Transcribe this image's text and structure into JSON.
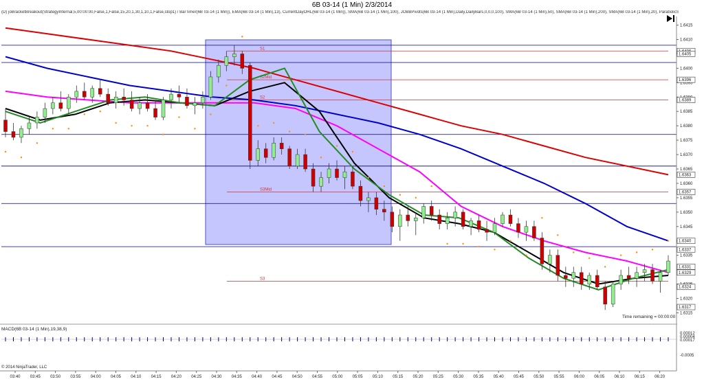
{
  "header": {
    "title": "6B 03-14 (1 Min)  2/3/2014",
    "indicators": "(D) joBracketBreakout(StrategyInternal,5,00:00:00,False,1,False,15,20,1,30,1,10,1,False,stop1) / BarTimer(6B 03-14 (1 Min)), EMA(6B 03-14 (1 Min),13), CurrentDayOHL(6B 03-14 (1 Min)), SMA(6B 03-14 (1 Min),100), JOBBPivots(6B 03-14 (1 Min),Daily,DailyBars,0,0,0,100), SMA(6B 03-14 (1 Min),50), SMA(6B 03-14 (1 Min),200), SMA(6B 03-14 (1 Min),20), ParabolicSAR(6B"
  },
  "footer": {
    "copyright": "© 2014 NinjaTrader, LLC",
    "time_remaining": "Time remaining = 00:00:00",
    "macd_label": "MACD(6B 03-14 (1 Min),19,38,9)"
  },
  "colors": {
    "up": "#90ee90",
    "down": "#cc0000",
    "ema13": "#228b22",
    "sma20": "#000000",
    "sma50": "#ff00ff",
    "sma100": "#0000cd",
    "sma200": "#dd0000",
    "psar": "#ff8c00",
    "pivot_line": "#cc3333",
    "day_line": "#000080",
    "box": "#8080ff"
  },
  "chart_data": {
    "type": "candlestick",
    "x_ticks": [
      "03:40",
      "03:45",
      "03:50",
      "03:55",
      "04:00",
      "04:05",
      "04:10",
      "04:15",
      "04:20",
      "04:25",
      "04:30",
      "04:35",
      "04:40",
      "04:45",
      "04:50",
      "04:55",
      "05:00",
      "05:05",
      "05:10",
      "05:15",
      "05:20",
      "05:25",
      "05:30",
      "05:35",
      "05:40",
      "05:45",
      "05:50",
      "05:55",
      "06:00",
      "06:05",
      "06:10",
      "06:15",
      "06:20"
    ],
    "y_ticks": [
      "1.6415",
      "1.6410",
      "1.6405",
      "1.6400",
      "1.6395",
      "1.6390",
      "1.6385",
      "1.6380",
      "1.6375",
      "1.6370",
      "1.6365",
      "1.6360",
      "1.6355",
      "1.6350",
      "1.6345",
      "1.6340",
      "1.6335",
      "1.6330",
      "1.6325",
      "1.6320",
      "1.6315"
    ],
    "ylim": [
      1.6312,
      1.6418
    ],
    "pivots": [
      {
        "name": "S1",
        "value": 1.6406
      },
      {
        "name": "S2Mid",
        "value": 1.6396
      },
      {
        "name": "S2",
        "value": 1.6389
      },
      {
        "name": "S3Mid",
        "value": 1.6357
      },
      {
        "name": "S3",
        "value": 1.6326
      }
    ],
    "day_lines": [
      1.6408,
      1.6402,
      1.6377,
      1.6366,
      1.6353,
      1.6338
    ],
    "price_markers": [
      "1.6406",
      "1.6405",
      "1.6396",
      "1.6389",
      "1.6363",
      "1.6357",
      "1.6340",
      "1.6337",
      "1.6331",
      "1.6329",
      "1.6324",
      "1.6317"
    ],
    "macd_ticks": [
      "0.00012",
      "0.00004",
      "0.00017",
      "-0.0005"
    ],
    "candles": [
      [
        1.6382,
        1.6386,
        1.6376,
        1.6378
      ],
      [
        1.6378,
        1.6381,
        1.6375,
        1.6376
      ],
      [
        1.6376,
        1.638,
        1.6374,
        1.6379
      ],
      [
        1.6379,
        1.6383,
        1.6377,
        1.6381
      ],
      [
        1.6381,
        1.6385,
        1.6379,
        1.6383
      ],
      [
        1.6383,
        1.6388,
        1.6381,
        1.6386
      ],
      [
        1.6386,
        1.639,
        1.6384,
        1.6388
      ],
      [
        1.6388,
        1.6392,
        1.6385,
        1.6386
      ],
      [
        1.6386,
        1.6391,
        1.6384,
        1.639
      ],
      [
        1.639,
        1.6394,
        1.6388,
        1.6392
      ],
      [
        1.6392,
        1.6395,
        1.6389,
        1.639
      ],
      [
        1.639,
        1.6394,
        1.6388,
        1.6393
      ],
      [
        1.6393,
        1.6396,
        1.639,
        1.6391
      ],
      [
        1.6391,
        1.6393,
        1.6387,
        1.6388
      ],
      [
        1.6388,
        1.6392,
        1.6386,
        1.639
      ],
      [
        1.639,
        1.6393,
        1.6387,
        1.6389
      ],
      [
        1.6389,
        1.6392,
        1.6385,
        1.6386
      ],
      [
        1.6386,
        1.639,
        1.6384,
        1.6388
      ],
      [
        1.6388,
        1.6391,
        1.6385,
        1.6386
      ],
      [
        1.6386,
        1.6389,
        1.6382,
        1.6383
      ],
      [
        1.6383,
        1.639,
        1.6382,
        1.6389
      ],
      [
        1.6389,
        1.6393,
        1.6386,
        1.6391
      ],
      [
        1.6391,
        1.6394,
        1.6388,
        1.639
      ],
      [
        1.639,
        1.6393,
        1.6386,
        1.6387
      ],
      [
        1.6387,
        1.639,
        1.6384,
        1.6388
      ],
      [
        1.6388,
        1.6392,
        1.6386,
        1.639
      ],
      [
        1.639,
        1.6399,
        1.6389,
        1.6397
      ],
      [
        1.6397,
        1.6403,
        1.6395,
        1.6401
      ],
      [
        1.6401,
        1.6406,
        1.6399,
        1.6404
      ],
      [
        1.6404,
        1.6408,
        1.6401,
        1.6405
      ],
      [
        1.6405,
        1.6406,
        1.6398,
        1.64
      ],
      [
        1.6401,
        1.6402,
        1.6365,
        1.6368
      ],
      [
        1.6368,
        1.6375,
        1.6366,
        1.6372
      ],
      [
        1.6372,
        1.6374,
        1.6367,
        1.6369
      ],
      [
        1.6369,
        1.6376,
        1.6368,
        1.6374
      ],
      [
        1.6374,
        1.6376,
        1.637,
        1.6372
      ],
      [
        1.6372,
        1.6373,
        1.6365,
        1.6366
      ],
      [
        1.6366,
        1.6372,
        1.6365,
        1.637
      ],
      [
        1.637,
        1.6372,
        1.6364,
        1.6365
      ],
      [
        1.6365,
        1.6367,
        1.6357,
        1.6359
      ],
      [
        1.6359,
        1.6364,
        1.6357,
        1.6362
      ],
      [
        1.6362,
        1.6367,
        1.636,
        1.6365
      ],
      [
        1.6365,
        1.6368,
        1.6361,
        1.6362
      ],
      [
        1.6362,
        1.6366,
        1.6358,
        1.6364
      ],
      [
        1.6364,
        1.6366,
        1.6358,
        1.6359
      ],
      [
        1.6359,
        1.6361,
        1.6352,
        1.6354
      ],
      [
        1.6354,
        1.6357,
        1.635,
        1.6355
      ],
      [
        1.6355,
        1.6357,
        1.6349,
        1.6351
      ],
      [
        1.6351,
        1.6354,
        1.6347,
        1.635
      ],
      [
        1.635,
        1.6352,
        1.6343,
        1.6345
      ],
      [
        1.6345,
        1.6351,
        1.634,
        1.6349
      ],
      [
        1.6349,
        1.6352,
        1.6345,
        1.6347
      ],
      [
        1.6347,
        1.635,
        1.6342,
        1.6348
      ],
      [
        1.6348,
        1.6353,
        1.6346,
        1.6352
      ],
      [
        1.6352,
        1.6354,
        1.6347,
        1.6349
      ],
      [
        1.6349,
        1.6351,
        1.6344,
        1.6346
      ],
      [
        1.6346,
        1.635,
        1.6344,
        1.6348
      ],
      [
        1.6348,
        1.6352,
        1.6345,
        1.635
      ],
      [
        1.635,
        1.6351,
        1.6344,
        1.6345
      ],
      [
        1.6345,
        1.6348,
        1.6342,
        1.6347
      ],
      [
        1.6347,
        1.6349,
        1.6343,
        1.6344
      ],
      [
        1.6344,
        1.6347,
        1.634,
        1.6343
      ],
      [
        1.6343,
        1.6348,
        1.6342,
        1.6346
      ],
      [
        1.6346,
        1.635,
        1.6345,
        1.6349
      ],
      [
        1.6349,
        1.6351,
        1.6345,
        1.6346
      ],
      [
        1.6346,
        1.6348,
        1.6341,
        1.6343
      ],
      [
        1.6343,
        1.6347,
        1.634,
        1.6345
      ],
      [
        1.6345,
        1.6347,
        1.634,
        1.6341
      ],
      [
        1.6341,
        1.6343,
        1.633,
        1.6332
      ],
      [
        1.6332,
        1.6337,
        1.6329,
        1.6335
      ],
      [
        1.6335,
        1.6337,
        1.6326,
        1.6328
      ],
      [
        1.6328,
        1.6331,
        1.6324,
        1.6327
      ],
      [
        1.6327,
        1.6331,
        1.6324,
        1.6329
      ],
      [
        1.6329,
        1.6331,
        1.6323,
        1.6325
      ],
      [
        1.6325,
        1.6329,
        1.6323,
        1.6328
      ],
      [
        1.6328,
        1.633,
        1.6323,
        1.6324
      ],
      [
        1.6324,
        1.6326,
        1.6316,
        1.6318
      ],
      [
        1.6318,
        1.6326,
        1.6317,
        1.6325
      ],
      [
        1.6325,
        1.633,
        1.6323,
        1.6328
      ],
      [
        1.6328,
        1.6331,
        1.6325,
        1.6327
      ],
      [
        1.6327,
        1.6331,
        1.6324,
        1.6329
      ],
      [
        1.6329,
        1.6332,
        1.6326,
        1.633
      ],
      [
        1.633,
        1.6332,
        1.6325,
        1.6326
      ],
      [
        1.6326,
        1.633,
        1.6322,
        1.6329
      ],
      [
        1.6329,
        1.6335,
        1.6328,
        1.6333
      ]
    ],
    "series": [
      {
        "name": "SMA(200)",
        "values": [
          1.6414,
          1.6412,
          1.641,
          1.6408,
          1.6406,
          1.6403,
          1.64,
          1.6396,
          1.6392,
          1.6388,
          1.6384,
          1.638,
          1.6377,
          1.6373,
          1.6369,
          1.6366,
          1.6363
        ]
      },
      {
        "name": "SMA(100)",
        "values": [
          1.6404,
          1.64,
          1.6397,
          1.6394,
          1.6392,
          1.639,
          1.6389,
          1.6387,
          1.6384,
          1.6381,
          1.6377,
          1.6372,
          1.6366,
          1.636,
          1.6353,
          1.6345,
          1.634
        ]
      },
      {
        "name": "SMA(50)",
        "values": [
          1.6392,
          1.639,
          1.6389,
          1.6388,
          1.6388,
          1.6388,
          1.6388,
          1.6386,
          1.638,
          1.6372,
          1.6364,
          1.6352,
          1.6345,
          1.634,
          1.6336,
          1.6333,
          1.6329
        ]
      },
      {
        "name": "SMA(20)",
        "values": [
          1.6386,
          1.6382,
          1.6384,
          1.6388,
          1.6389,
          1.6388,
          1.6387,
          1.6392,
          1.6395,
          1.6385,
          1.6367,
          1.6355,
          1.6348,
          1.6346,
          1.6343,
          1.6336,
          1.6329,
          1.6325,
          1.6327,
          1.6328
        ]
      },
      {
        "name": "EMA(13)",
        "values": [
          1.6385,
          1.6381,
          1.6385,
          1.6389,
          1.639,
          1.6388,
          1.6387,
          1.6396,
          1.64,
          1.6378,
          1.6365,
          1.6356,
          1.6349,
          1.6348,
          1.6343,
          1.6334,
          1.6327,
          1.6323,
          1.6327,
          1.633
        ]
      }
    ]
  }
}
